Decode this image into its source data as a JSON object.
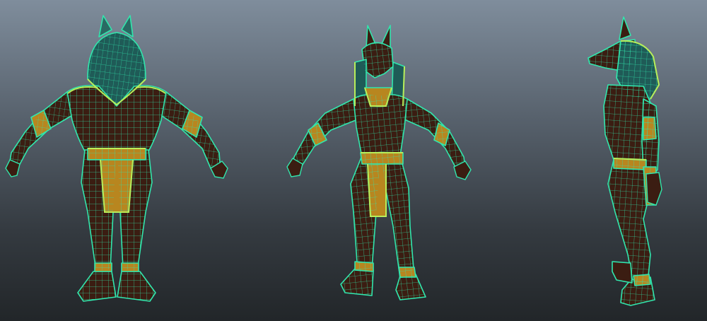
{
  "viewport": {
    "background": {
      "top": "#7f8d9c",
      "middle": "#4a535d",
      "bottom": "#222629"
    },
    "wire_color": "#31e6ad",
    "wire_highlight": "#b8ee5a",
    "skin_color": "#3b1d12",
    "gold_color": "#b8861f",
    "headdress_color": "#1f5b57"
  },
  "views": [
    {
      "id": "front",
      "icon": "anubis-wireframe-front-view"
    },
    {
      "id": "perspective",
      "icon": "anubis-wireframe-three-quarter-view"
    },
    {
      "id": "side",
      "icon": "anubis-wireframe-side-view"
    }
  ]
}
